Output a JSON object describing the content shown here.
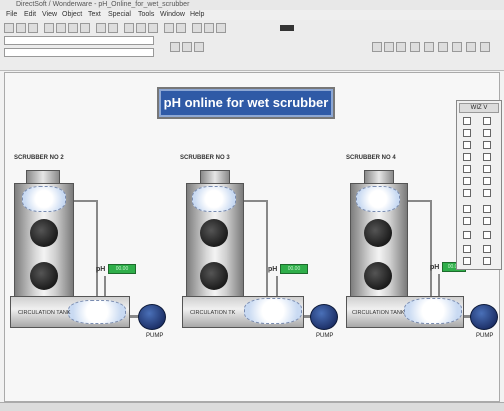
{
  "window": {
    "title": "DirectSoft / Wonderware - pH_Online_for_wet_scrubber"
  },
  "menu": [
    "File",
    "Edit",
    "View",
    "Object",
    "Text",
    "Special",
    "Tools",
    "Window",
    "Help"
  ],
  "title_button": "pH online for wet scrubber",
  "scrubbers": [
    {
      "label": "SCRUBBER NO 2",
      "tank_label": "CIRCULATION TANK",
      "ph_label": "pH",
      "ph_value": "00.00",
      "pump_label": "PUMP"
    },
    {
      "label": "SCRUBBER NO 3",
      "tank_label": "CIRCULATION TK",
      "ph_label": "pH",
      "ph_value": "00.00",
      "pump_label": "PUMP"
    },
    {
      "label": "SCRUBBER NO 4",
      "tank_label": "CIRCULATION TANK",
      "ph_label": "pH",
      "ph_value": "00.00",
      "pump_label": "PUMP"
    }
  ],
  "tool_panel": {
    "header": "WIZ V"
  },
  "colors": {
    "title_bg": "#2f5aa6",
    "ph_display": "#2fae4a",
    "pump": "#1c2f66"
  }
}
